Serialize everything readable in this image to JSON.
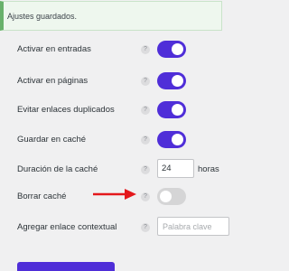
{
  "notice": {
    "text": "Ajustes guardados."
  },
  "settings": [
    {
      "label": "Activar en entradas",
      "help": "?",
      "type": "toggle",
      "on": true
    },
    {
      "label": "Activar en páginas",
      "help": "?",
      "type": "toggle",
      "on": true
    },
    {
      "label": "Evitar enlaces duplicados",
      "help": "?",
      "type": "toggle",
      "on": true
    },
    {
      "label": "Guardar en caché",
      "help": "?",
      "type": "toggle",
      "on": true
    }
  ],
  "cache_duration": {
    "label": "Duración de la caché",
    "help": "?",
    "value": "24",
    "unit": "horas"
  },
  "clear_cache": {
    "label": "Borrar caché",
    "help": "?",
    "type": "toggle",
    "on": false
  },
  "contextual_link": {
    "label": "Agregar enlace contextual",
    "help": "?",
    "placeholder": "Palabra clave"
  },
  "colors": {
    "accent": "#4f2ed8",
    "toggle_off": "#d5d5d6",
    "notice_border": "#68b16b",
    "arrow": "#e4181c"
  },
  "icons": {
    "help": "help-icon",
    "arrow": "red-arrow-icon"
  }
}
